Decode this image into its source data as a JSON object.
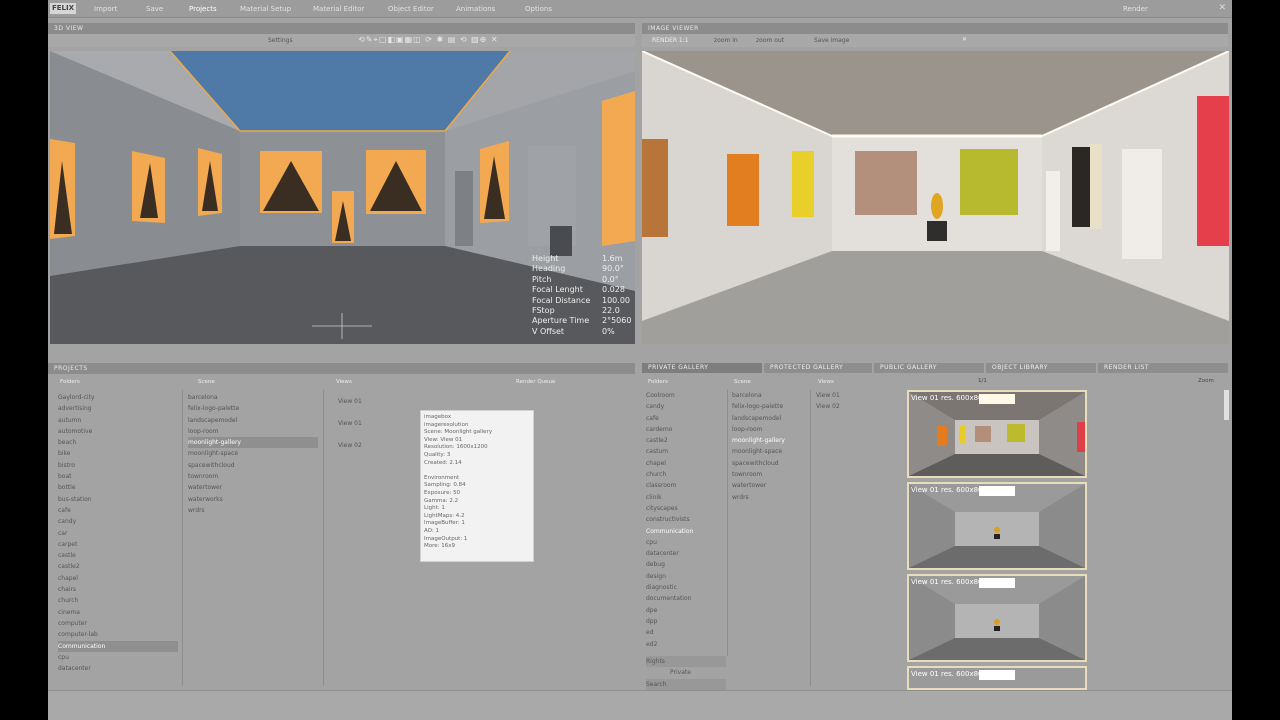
{
  "menu": {
    "logo": "FELIX",
    "items": [
      "Import",
      "Save",
      "Projects",
      "Material Setup",
      "Material Editor",
      "Object Editor",
      "Animations",
      "Options"
    ],
    "render": "Render"
  },
  "viewport_3d": {
    "title": "3D VIEW",
    "settings": "Settings",
    "stats": {
      "labels": [
        "Height",
        "Heading",
        "Pitch",
        "Focal Lenght",
        "Focal Distance",
        "FStop",
        "Aperture Time",
        "V Offset"
      ],
      "values": [
        "1.6m",
        "90.0°",
        "0.0°",
        "0.028",
        "100.00",
        "22.0",
        "2°5060",
        "0%"
      ]
    }
  },
  "render_view": {
    "title": "IMAGE VIEWER",
    "toolbar": [
      "RENDER 1:1",
      "zoom in",
      "zoom out",
      "Save image"
    ]
  },
  "projects": {
    "title": "PROJECTS",
    "col_headers": [
      "Folders",
      "Scene",
      "Views",
      "Render Queue"
    ],
    "folders": [
      "Gaylord-city",
      "advertising",
      "autumn",
      "automotive",
      "beach",
      "bike",
      "bistro",
      "boat",
      "bottle",
      "bus-station",
      "cafe",
      "candy",
      "car",
      "carpet",
      "castle",
      "castle2",
      "chapel",
      "chairs",
      "church",
      "cinema",
      "computer",
      "computer-lab",
      "Communication",
      "cpu",
      "datacenter"
    ],
    "scenes": [
      "barcelona",
      "felix-logo-palette",
      "landscapemodel",
      "loop-room",
      "moonlight-gallery",
      "moonlight-space",
      "spacewithcloud",
      "townroom",
      "watertower",
      "waterworks",
      "wrdrs"
    ],
    "views": [
      "View 01",
      "View 01",
      "View 02"
    ],
    "popup_lines": [
      "imagebox",
      "imageresolution",
      "Scene: Moonlight gallery",
      "View: View 01",
      "Resolution: 1600x1200",
      "Quality: 3",
      "Created: 2.14",
      "",
      "Environment",
      "Sampling: 0.84",
      "Exposure: 50",
      "Gamma: 2.2",
      "Light: 1",
      "LightMaps: 4.2",
      "ImageBuffer: 1",
      "AO: 1",
      "ImageOutput: 1",
      "More: 16x9"
    ]
  },
  "galleries": {
    "tabs": [
      "PRIVATE GALLERY",
      "PROTECTED GALLERY",
      "PUBLIC GALLERY",
      "OBJECT LIBRARY",
      "RENDER LIST"
    ],
    "col_headers": [
      "Folders",
      "Scene",
      "Views"
    ],
    "folders": [
      "Coolroom",
      "candy",
      "cafe",
      "cardemo",
      "castle2",
      "castum",
      "chapel",
      "church",
      "classroom",
      "clinik",
      "cityscapes",
      "constructivists",
      "Communication",
      "cpu",
      "datacenter",
      "debug",
      "design",
      "diagnostic",
      "documentation",
      "dpe",
      "dpp",
      "ed",
      "ed2"
    ],
    "scenes": [
      "barcelona",
      "felix-logo-palette",
      "landscapemodel",
      "loop-room",
      "moonlight-gallery",
      "moonlight-space",
      "spacewithcloud",
      "townroom",
      "watertower",
      "wrdrs"
    ],
    "views": [
      "View 01",
      "View 02"
    ],
    "pager": "1/1",
    "zoom": "Zoom",
    "extra": [
      "Rights",
      "Private",
      "Search"
    ],
    "thumbs": [
      "View 01 res. 600x800",
      "View 01 res. 600x800",
      "View 01 res. 600x800",
      "View 01 res. 600x800"
    ]
  }
}
